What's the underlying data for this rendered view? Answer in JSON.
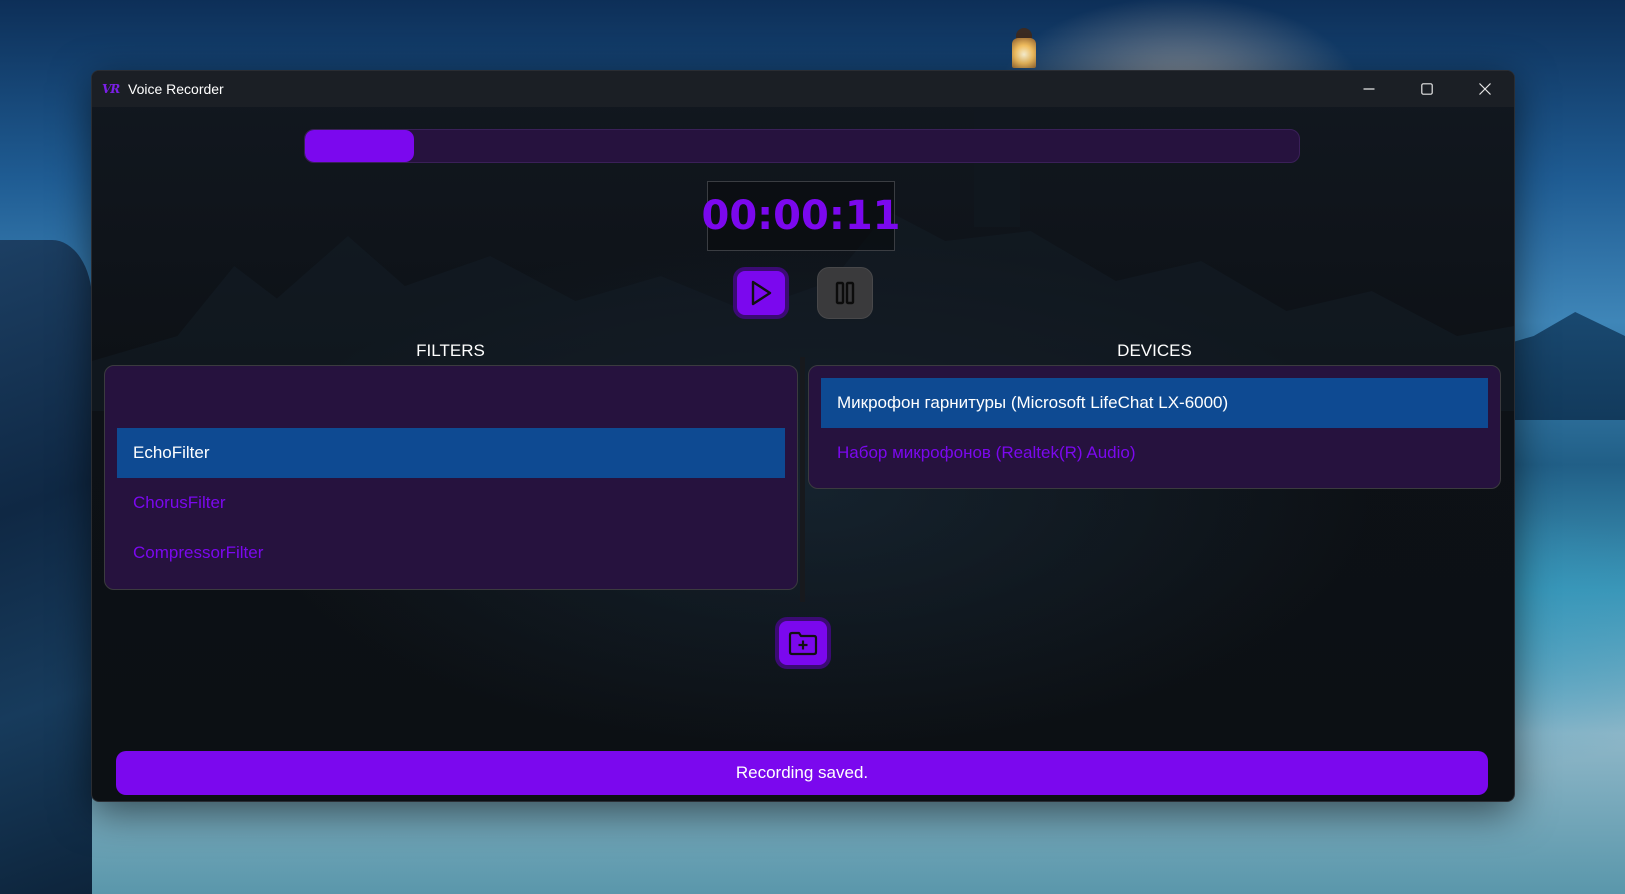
{
  "window": {
    "title": "Voice Recorder",
    "app_icon_text": "VR",
    "controls": {
      "minimize_icon": "minimize-icon",
      "maximize_icon": "maximize-icon",
      "close_icon": "close-icon"
    }
  },
  "recording": {
    "progress_fraction": 0.11,
    "timer": "00:00:11",
    "play_icon": "play-icon",
    "pause_icon": "pause-icon"
  },
  "filters": {
    "label": "FILTERS",
    "items": [
      {
        "label": "",
        "selected": false
      },
      {
        "label": "EchoFilter",
        "selected": true
      },
      {
        "label": "ChorusFilter",
        "selected": false
      },
      {
        "label": "CompressorFilter",
        "selected": false
      }
    ]
  },
  "devices": {
    "label": "DEVICES",
    "items": [
      {
        "label": "Микрофон гарнитуры (Microsoft LifeChat LX-6000)",
        "selected": true
      },
      {
        "label": "Набор микрофонов (Realtek(R) Audio)",
        "selected": false
      }
    ]
  },
  "actions": {
    "open_folder_icon": "folder-plus-icon"
  },
  "status": {
    "message": "Recording saved."
  },
  "colors": {
    "accent": "#7b08ee",
    "panel": "#26123e",
    "selection": "#0e4a92",
    "titlebar": "#1b1f25"
  }
}
